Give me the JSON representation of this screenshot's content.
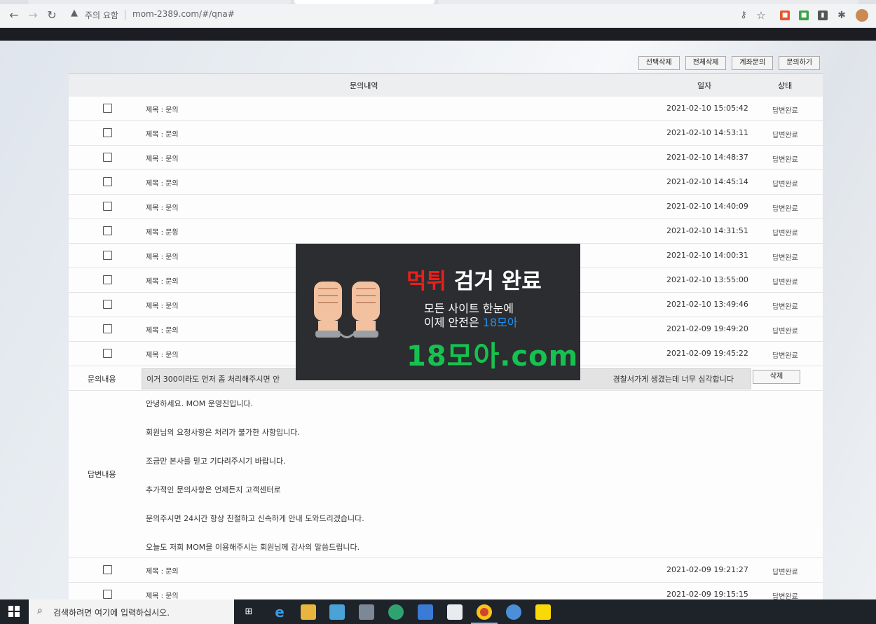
{
  "browser": {
    "security_label": "주의 요함",
    "url": "mom-2389.com/#/qna#"
  },
  "toolbar": {
    "buttons": [
      "선택삭제",
      "전체삭제",
      "계좌문의",
      "문의하기"
    ]
  },
  "table": {
    "headers": {
      "content": "문의내역",
      "date": "일자",
      "status": "상태"
    },
    "rows_before": [
      {
        "title": "제목 : 문의",
        "date": "2021-02-10 15:05:42",
        "status": "답변완료"
      },
      {
        "title": "제목 : 문의",
        "date": "2021-02-10 14:53:11",
        "status": "답변완료"
      },
      {
        "title": "제목 : 문의",
        "date": "2021-02-10 14:48:37",
        "status": "답변완료"
      },
      {
        "title": "제목 : 문의",
        "date": "2021-02-10 14:45:14",
        "status": "답변완료"
      },
      {
        "title": "제목 : 문의",
        "date": "2021-02-10 14:40:09",
        "status": "답변완료"
      },
      {
        "title": "제목 : 문읭",
        "date": "2021-02-10 14:31:51",
        "status": "답변완료"
      },
      {
        "title": "제목 : 문의",
        "date": "2021-02-10 14:00:31",
        "status": "답변완료"
      },
      {
        "title": "제목 : 문의",
        "date": "2021-02-10 13:55:00",
        "status": "답변완료"
      },
      {
        "title": "제목 : 문의",
        "date": "2021-02-10 13:49:46",
        "status": "답변완료"
      },
      {
        "title": "제목 : 문의",
        "date": "2021-02-09 19:49:20",
        "status": "답변완료"
      },
      {
        "title": "제목 : 문의",
        "date": "2021-02-09 19:45:22",
        "status": "답변완료"
      }
    ],
    "inquiry": {
      "label": "문의내용",
      "text_start": "이거 300이라도 먼저 좀 처리해주시면 안",
      "text_end": "경찰서가게 생겼는데 너무 심각합니다",
      "delete_label": "삭제"
    },
    "answer": {
      "label": "답변내용",
      "lines": [
        "안녕하세요. MOM 운영진입니다.",
        "회원님의 요청사항은 처리가 불가한 사항입니다.",
        "조금만 본사를 믿고 기다려주시기 바랍니다.",
        "추가적인 문의사항은 언제든지 고객센터로",
        "문의주시면 24시간 항상 친절하고 신속하게 안내 도와드리겠습니다.",
        "오늘도 저희 MOM을 이용해주시는 회원님께 감사의 말씀드립니다."
      ]
    },
    "rows_after": [
      {
        "title": "제목 : 문의",
        "date": "2021-02-09 19:21:27",
        "status": "답변완료"
      },
      {
        "title": "제목 : 문의",
        "date": "2021-02-09 19:15:15",
        "status": "답변완료"
      }
    ]
  },
  "ad": {
    "line1_red": "먹튀",
    "line1_rest": " 검거 완료",
    "line2": "모든 사이트 한눈에",
    "line3_start": "이제 안전은 ",
    "line3_blue": "18모아",
    "big": "18모아.com"
  },
  "taskbar": {
    "search_placeholder": "검색하려면 여기에 입력하십시오."
  }
}
